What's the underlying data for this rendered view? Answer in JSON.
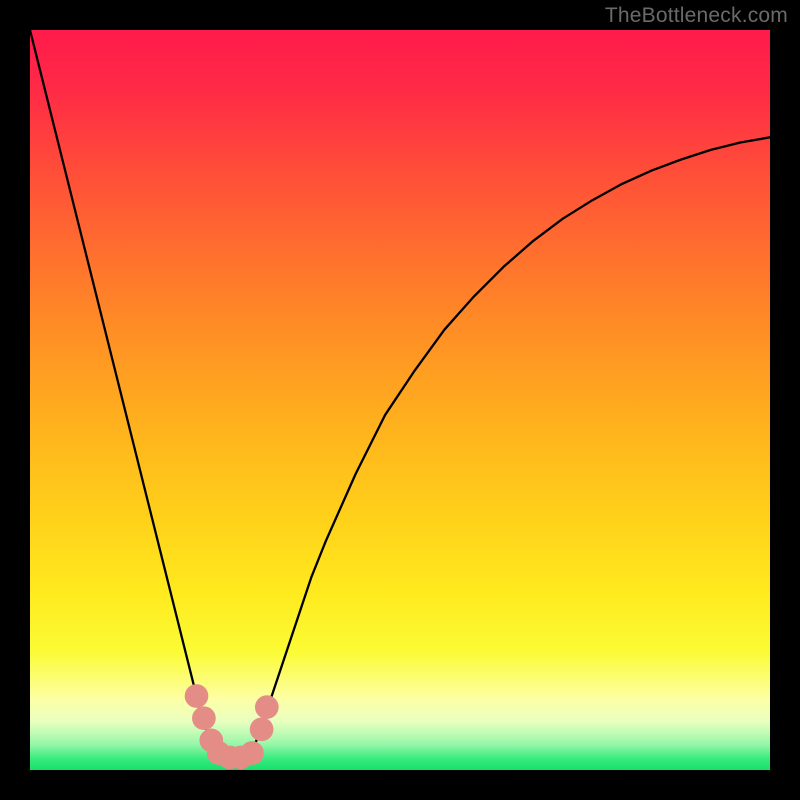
{
  "watermark": "TheBottleneck.com",
  "chart_data": {
    "type": "line",
    "title": "",
    "xlabel": "",
    "ylabel": "",
    "xlim": [
      0,
      100
    ],
    "ylim": [
      0,
      100
    ],
    "series": [
      {
        "name": "curve",
        "color": "#000000",
        "x": [
          0,
          2,
          4,
          6,
          8,
          10,
          12,
          14,
          16,
          18,
          20,
          21,
          22,
          23,
          24,
          25,
          26,
          27,
          28,
          29,
          30,
          31,
          32,
          34,
          36,
          38,
          40,
          44,
          48,
          52,
          56,
          60,
          64,
          68,
          72,
          76,
          80,
          84,
          88,
          92,
          96,
          100
        ],
        "y": [
          100,
          92,
          84,
          76,
          68,
          60,
          52,
          44,
          36,
          28,
          20,
          16,
          12,
          8,
          5,
          2.5,
          1.5,
          1.2,
          1.2,
          1.5,
          2.5,
          5,
          8,
          14,
          20,
          26,
          31,
          40,
          48,
          54,
          59.5,
          64,
          68,
          71.5,
          74.5,
          77,
          79.2,
          81,
          82.5,
          83.8,
          84.8,
          85.5
        ]
      }
    ],
    "markers": [
      {
        "x": 22.5,
        "y": 10,
        "color": "#e48d87",
        "r": 1.6
      },
      {
        "x": 23.5,
        "y": 7,
        "color": "#e48d87",
        "r": 1.6
      },
      {
        "x": 24.5,
        "y": 4,
        "color": "#e48d87",
        "r": 1.6
      },
      {
        "x": 25.5,
        "y": 2.3,
        "color": "#e48d87",
        "r": 1.6
      },
      {
        "x": 27.0,
        "y": 1.7,
        "color": "#e48d87",
        "r": 1.6
      },
      {
        "x": 28.5,
        "y": 1.7,
        "color": "#e48d87",
        "r": 1.6
      },
      {
        "x": 30.0,
        "y": 2.3,
        "color": "#e48d87",
        "r": 1.6
      },
      {
        "x": 31.3,
        "y": 5.5,
        "color": "#e48d87",
        "r": 1.6
      },
      {
        "x": 32.0,
        "y": 8.5,
        "color": "#e48d87",
        "r": 1.6
      }
    ],
    "background_gradient": {
      "stops": [
        {
          "offset": 0.0,
          "color": "#ff1b4b"
        },
        {
          "offset": 0.08,
          "color": "#ff2a46"
        },
        {
          "offset": 0.18,
          "color": "#ff4a3a"
        },
        {
          "offset": 0.3,
          "color": "#ff6f2e"
        },
        {
          "offset": 0.42,
          "color": "#ff9224"
        },
        {
          "offset": 0.54,
          "color": "#ffb31d"
        },
        {
          "offset": 0.66,
          "color": "#ffd11a"
        },
        {
          "offset": 0.76,
          "color": "#ffea1e"
        },
        {
          "offset": 0.84,
          "color": "#fbfb35"
        },
        {
          "offset": 0.905,
          "color": "#fdffa6"
        },
        {
          "offset": 0.935,
          "color": "#e8ffc0"
        },
        {
          "offset": 0.965,
          "color": "#97f7a9"
        },
        {
          "offset": 0.985,
          "color": "#37eb7e"
        },
        {
          "offset": 1.0,
          "color": "#17e06d"
        }
      ]
    }
  }
}
